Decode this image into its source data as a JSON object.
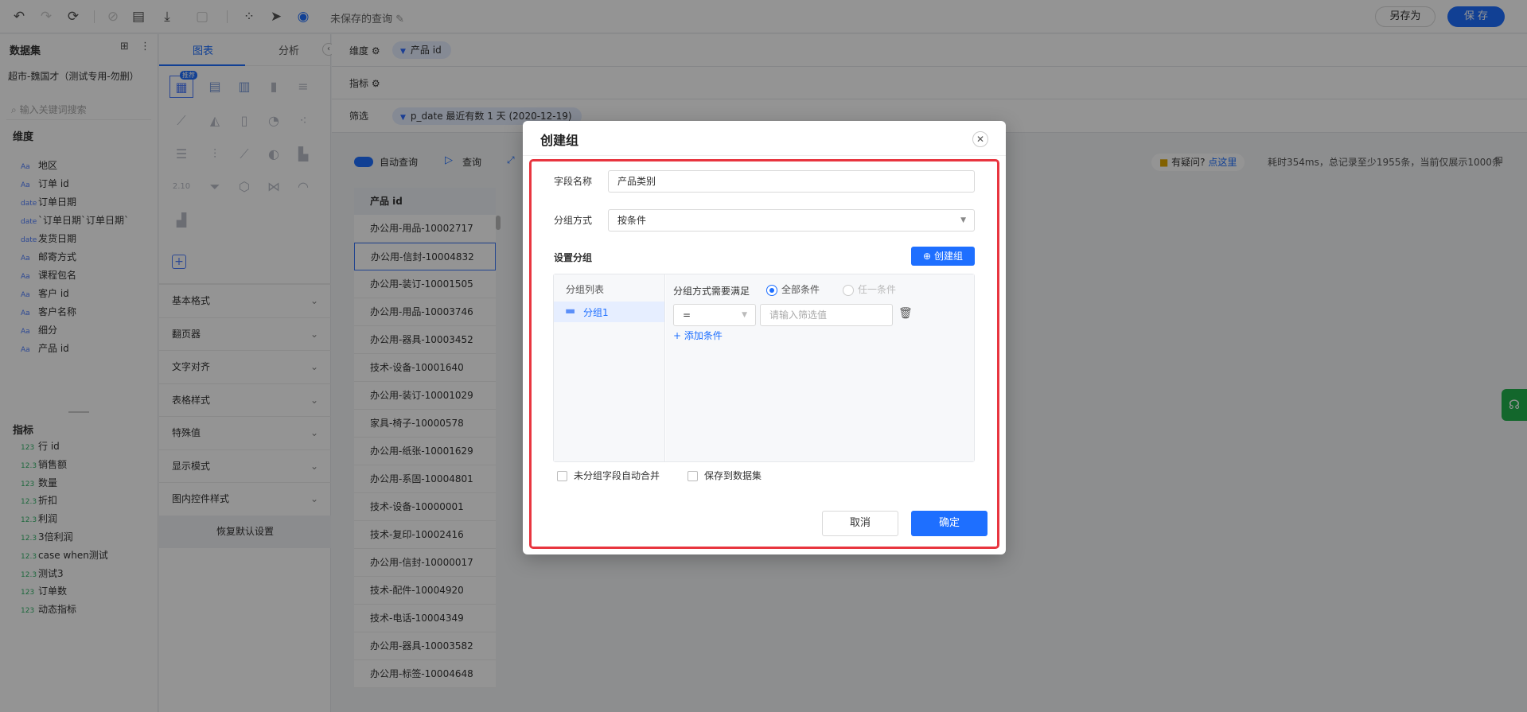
{
  "toolbar": {
    "unsaved_label": "未保存的查询",
    "saveas_label": "另存为",
    "save_label": "保 存"
  },
  "dataset": {
    "title": "数据集",
    "name": "超市-魏国才（测试专用-勿删）",
    "search_placeholder": "输入关键词搜索",
    "dimension_title": "维度",
    "dimensions": [
      {
        "type": "Aa",
        "label": "地区"
      },
      {
        "type": "Aa",
        "label": "订单 id"
      },
      {
        "type": "date",
        "label": "订单日期"
      },
      {
        "type": "date",
        "label": "`订单日期`订单日期`"
      },
      {
        "type": "date",
        "label": "发货日期"
      },
      {
        "type": "Aa",
        "label": "邮寄方式"
      },
      {
        "type": "Aa",
        "label": "课程包名"
      },
      {
        "type": "Aa",
        "label": "客户 id"
      },
      {
        "type": "Aa",
        "label": "客户名称"
      },
      {
        "type": "Aa",
        "label": "细分"
      },
      {
        "type": "Aa",
        "label": "产品 id"
      }
    ],
    "metric_title": "指标",
    "metrics": [
      {
        "type": "123",
        "label": "行 id"
      },
      {
        "type": "12.3",
        "label": "销售额"
      },
      {
        "type": "123",
        "label": "数量"
      },
      {
        "type": "12.3",
        "label": "折扣"
      },
      {
        "type": "12.3",
        "label": "利润"
      },
      {
        "type": "12.3",
        "label": "3倍利润"
      },
      {
        "type": "12.3",
        "label": "case when测试"
      },
      {
        "type": "12.3",
        "label": "测试3"
      },
      {
        "type": "123",
        "label": "订单数"
      },
      {
        "type": "123",
        "label": "动态指标"
      }
    ]
  },
  "config": {
    "tab_chart": "图表",
    "tab_analysis": "分析",
    "recommend_badge": "推荐",
    "rows": [
      "基本格式",
      "翻页器",
      "文字对齐",
      "表格样式",
      "特殊值",
      "显示模式",
      "图内控件样式"
    ],
    "reset_label": "恢复默认设置"
  },
  "main": {
    "dimension_label": "维度",
    "dimension_pill": "产品 id",
    "metric_label": "指标",
    "filter_label": "筛选",
    "filter_pill": "p_date 最近有数 1 天 (2020-12-19)",
    "auto_query_label": "自动查询",
    "query_label": "查询",
    "help_text": "有疑问?",
    "help_link": "点这里",
    "stats_text": "耗时354ms，总记录至少1955条，当前仅展示1000条",
    "table_header": "产品 id",
    "table_rows": [
      "办公用-用品-10002717",
      "办公用-信封-10004832",
      "办公用-装订-10001505",
      "办公用-用品-10003746",
      "办公用-器具-10003452",
      "技术-设备-10001640",
      "办公用-装订-10001029",
      "家具-椅子-10000578",
      "办公用-纸张-10001629",
      "办公用-系固-10004801",
      "技术-设备-10000001",
      "技术-复印-10002416",
      "办公用-信封-10000017",
      "技术-配件-10004920",
      "技术-电话-10004349",
      "办公用-器具-10003582",
      "办公用-标签-10004648"
    ]
  },
  "modal": {
    "title": "创建组",
    "field_name_label": "字段名称",
    "field_name_value": "产品类别",
    "group_method_label": "分组方式",
    "group_method_value": "按条件",
    "set_group_label": "设置分组",
    "create_group_button": "创建组",
    "group_list_title": "分组列表",
    "group_item": "分组1",
    "condition_label": "分组方式需要满足",
    "radio_all": "全部条件",
    "radio_any": "任一条件",
    "operator_value": "=",
    "filter_placeholder": "请输入筛选值",
    "add_condition": "添加条件",
    "check_merge": "未分组字段自动合并",
    "check_save": "保存到数据集",
    "cancel_label": "取消",
    "ok_label": "确定"
  }
}
